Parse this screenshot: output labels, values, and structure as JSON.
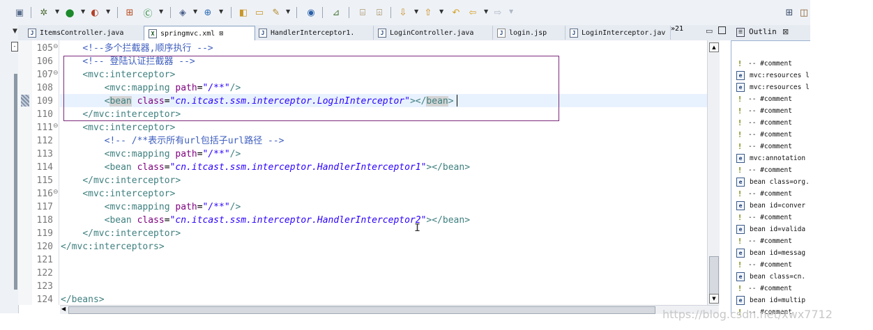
{
  "toolbar": {
    "more_label": "»"
  },
  "tabs": [
    {
      "label": "ItemsController.java",
      "icon": "J"
    },
    {
      "label": "springmvc.xml",
      "icon": "X",
      "active": true
    },
    {
      "label": "HandlerInterceptor1.",
      "icon": "J"
    },
    {
      "label": "LoginController.java",
      "icon": "J"
    },
    {
      "label": "login.jsp",
      "icon": "J"
    },
    {
      "label": "LoginInterceptor.jav",
      "icon": "J"
    }
  ],
  "overflow_tabs": "»21",
  "outline": {
    "title": "Outlin",
    "items": [
      {
        "type": "comment",
        "text": "-- #comment"
      },
      {
        "type": "element",
        "text": "mvc:resources l"
      },
      {
        "type": "element",
        "text": "mvc:resources l"
      },
      {
        "type": "comment",
        "text": "-- #comment"
      },
      {
        "type": "comment",
        "text": "-- #comment"
      },
      {
        "type": "comment",
        "text": "-- #comment"
      },
      {
        "type": "comment",
        "text": "-- #comment"
      },
      {
        "type": "comment",
        "text": "-- #comment"
      },
      {
        "type": "element",
        "text": "mvc:annotation"
      },
      {
        "type": "comment",
        "text": "-- #comment"
      },
      {
        "type": "element",
        "text": "bean class=org."
      },
      {
        "type": "comment",
        "text": "-- #comment"
      },
      {
        "type": "element",
        "text": "bean id=conver"
      },
      {
        "type": "comment",
        "text": "-- #comment"
      },
      {
        "type": "element",
        "text": "bean id=valida"
      },
      {
        "type": "comment",
        "text": "-- #comment"
      },
      {
        "type": "element",
        "text": "bean id=messag"
      },
      {
        "type": "comment",
        "text": "-- #comment"
      },
      {
        "type": "element",
        "text": "bean class=cn."
      },
      {
        "type": "comment",
        "text": "-- #comment"
      },
      {
        "type": "element",
        "text": "bean id=multip"
      },
      {
        "type": "comment",
        "text": "-- #comment"
      }
    ]
  },
  "editor": {
    "lines": [
      {
        "num": "105",
        "fold": "⊖",
        "segs": [
          [
            "i",
            "    "
          ],
          [
            "cmt",
            "<!--多个拦截器,顺序执行 -->"
          ]
        ]
      },
      {
        "num": "106",
        "fold": "",
        "segs": [
          [
            "i",
            "    "
          ],
          [
            "cmt",
            "<!-- 登陆认证拦截器 -->"
          ]
        ]
      },
      {
        "num": "107",
        "fold": "⊖",
        "segs": [
          [
            "i",
            "    "
          ],
          [
            "tag",
            "<mvc:interceptor>"
          ]
        ]
      },
      {
        "num": "108",
        "fold": "",
        "segs": [
          [
            "i",
            "        "
          ],
          [
            "tag",
            "<mvc:mapping "
          ],
          [
            "attr",
            "path"
          ],
          [
            "p",
            "="
          ],
          [
            "str",
            "\"/**\""
          ],
          [
            "tag",
            "/>"
          ]
        ]
      },
      {
        "num": "109",
        "fold": "",
        "segs": [
          [
            "i",
            "        "
          ],
          [
            "tag",
            "<"
          ],
          [
            "hl",
            "bean"
          ],
          [
            "tag",
            " "
          ],
          [
            "attr",
            "class"
          ],
          [
            "p",
            "="
          ],
          [
            "str",
            "\"cn.itcast.ssm.interceptor.LoginInterceptor\""
          ],
          [
            "tag",
            "></"
          ],
          [
            "hl",
            "bean"
          ],
          [
            "tag",
            ">"
          ]
        ]
      },
      {
        "num": "110",
        "fold": "",
        "segs": [
          [
            "i",
            "    "
          ],
          [
            "tag",
            "</mvc:interceptor>"
          ]
        ]
      },
      {
        "num": "111",
        "fold": "⊖",
        "segs": [
          [
            "i",
            "    "
          ],
          [
            "tag",
            "<mvc:interceptor>"
          ]
        ]
      },
      {
        "num": "112",
        "fold": "",
        "segs": [
          [
            "i",
            "        "
          ],
          [
            "cmt",
            "<!-- /**表示所有url包括子url路径 -->"
          ]
        ]
      },
      {
        "num": "113",
        "fold": "",
        "segs": [
          [
            "i",
            "        "
          ],
          [
            "tag",
            "<mvc:mapping "
          ],
          [
            "attr",
            "path"
          ],
          [
            "p",
            "="
          ],
          [
            "str",
            "\"/**\""
          ],
          [
            "tag",
            "/>"
          ]
        ]
      },
      {
        "num": "114",
        "fold": "",
        "segs": [
          [
            "i",
            "        "
          ],
          [
            "tag",
            "<bean "
          ],
          [
            "attr",
            "class"
          ],
          [
            "p",
            "="
          ],
          [
            "str",
            "\"cn.itcast.ssm.interceptor.HandlerInterceptor1\""
          ],
          [
            "tag",
            "></bean>"
          ]
        ]
      },
      {
        "num": "115",
        "fold": "",
        "segs": [
          [
            "i",
            "    "
          ],
          [
            "tag",
            "</mvc:interceptor>"
          ]
        ]
      },
      {
        "num": "116",
        "fold": "⊖",
        "segs": [
          [
            "i",
            "    "
          ],
          [
            "tag",
            "<mvc:interceptor>"
          ]
        ]
      },
      {
        "num": "117",
        "fold": "",
        "segs": [
          [
            "i",
            "        "
          ],
          [
            "tag",
            "<mvc:mapping "
          ],
          [
            "attr",
            "path"
          ],
          [
            "p",
            "="
          ],
          [
            "str",
            "\"/**\""
          ],
          [
            "tag",
            "/>"
          ]
        ]
      },
      {
        "num": "118",
        "fold": "",
        "segs": [
          [
            "i",
            "        "
          ],
          [
            "tag",
            "<bean "
          ],
          [
            "attr",
            "class"
          ],
          [
            "p",
            "="
          ],
          [
            "str",
            "\"cn.itcast.ssm.interceptor.HandlerInterceptor2\""
          ],
          [
            "tag",
            "></bean>"
          ]
        ]
      },
      {
        "num": "119",
        "fold": "",
        "segs": [
          [
            "i",
            "    "
          ],
          [
            "tag",
            "</mvc:interceptor>"
          ]
        ]
      },
      {
        "num": "120",
        "fold": "",
        "segs": [
          [
            "tag",
            "</mvc:interceptors>"
          ]
        ]
      },
      {
        "num": "121",
        "fold": "",
        "segs": []
      },
      {
        "num": "122",
        "fold": "",
        "segs": []
      },
      {
        "num": "123",
        "fold": "",
        "segs": []
      },
      {
        "num": "124",
        "fold": "",
        "segs": [
          [
            "tag",
            "</beans>"
          ]
        ]
      }
    ]
  },
  "watermark": "https://blog.csdn.net/xwx7712"
}
